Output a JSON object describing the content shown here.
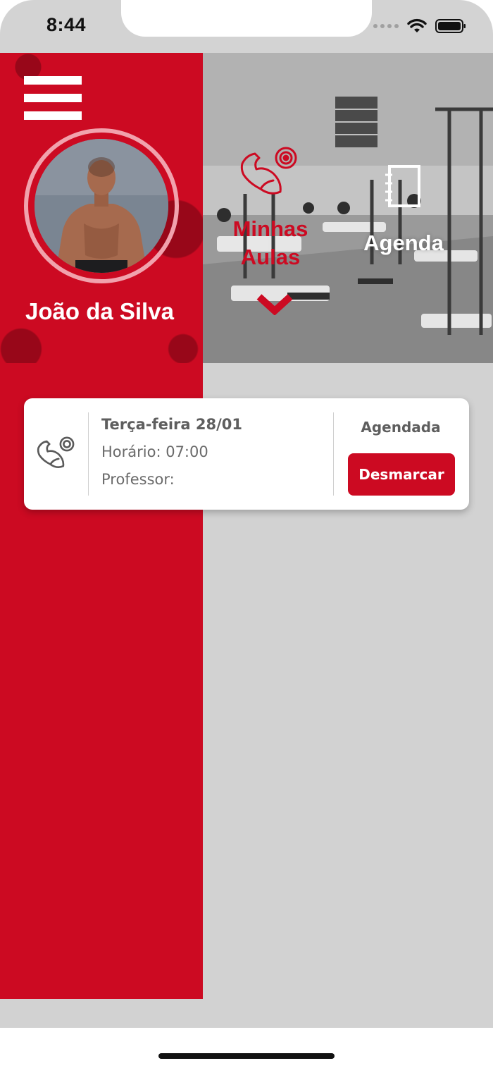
{
  "status_bar": {
    "time": "8:44"
  },
  "sidebar": {
    "user_name": "João da Silva"
  },
  "tabs": [
    {
      "label": "Minhas Aulas",
      "icon": "flexed-arm-dumbbell-icon",
      "active": true
    },
    {
      "label": "Agenda",
      "icon": "notebook-icon",
      "active": false
    }
  ],
  "class_card": {
    "date": "Terça-feira 28/01",
    "time": "Horário: 07:00",
    "professor": "Professor:",
    "status": "Agendada",
    "action_label": "Desmarcar"
  },
  "colors": {
    "accent": "#cc0a22",
    "background": "#d2d2d2",
    "card": "#ffffff"
  }
}
